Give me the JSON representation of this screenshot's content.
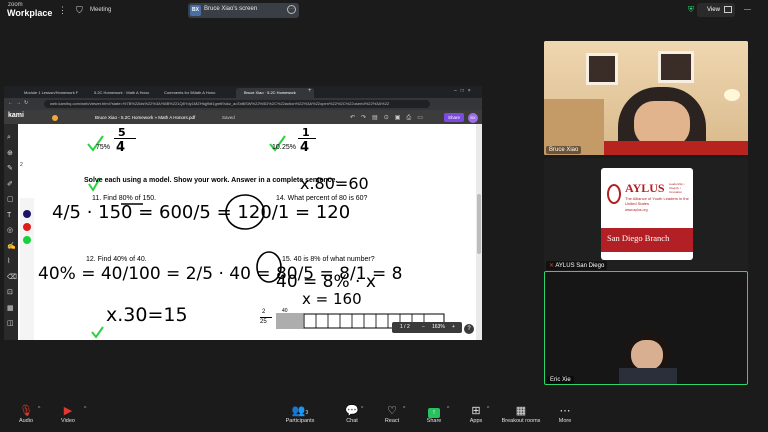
{
  "app": {
    "brand_top": "zoom",
    "brand_bottom": "Workplace"
  },
  "topbar": {
    "meeting_label": "Meeting",
    "share_initials": "BX",
    "share_title": "Bruce Xiao's screen",
    "view_label": "View"
  },
  "browser": {
    "tabs": [
      {
        "label": "Module 1 Lesson/Homework F"
      },
      {
        "label": "5.2C Homework · Math A Hono"
      },
      {
        "label": "Comments for 5Math A Hono"
      },
      {
        "label": "Bruce Xiao · 5.2C Homework"
      }
    ],
    "url": "web.kamihq.com/web/viewer.html?state=%7B%22ids%22%3A%5B%221Q6Ydy1MZHtqj9dt1gmtI9ukz_aoTaf6SW%22%5D%2C%22action%22%3A%22open%22%2C%22userId%22%3A%22"
  },
  "kami": {
    "logo": "kami",
    "breadcrumb": "Bruce Xiao - 5.2C Homework » Math A Honors.pdf",
    "saved": "Saved",
    "share": "Share",
    "user_initials": "BX",
    "tool_number": "2"
  },
  "doc": {
    "top_left_pct": "75%",
    "top_right_pct": "25%",
    "top_left_num": "5",
    "top_left_den": "4",
    "top_right_num": "1",
    "top_right_den": "4",
    "top_right_qn": "10.",
    "instructions": "Solve each using a model. Show your work. Answer in a complete sentence.",
    "q11": "11. Find 80% of 150.",
    "q14": "14. What percent of 80 is 60?",
    "q12": "12. Find 40% of 40.",
    "q15": "15. 40 is 8% of what number?",
    "hw_top": "x.80=60",
    "hw_q11": "4/5 · 150 = 600/5 = 120/1 = 120",
    "hw_q12": "40% = 40/100 = 2/5 · 40 = 80/5 = 8/1 = 8",
    "hw_q15_line1": "40 = 8% · x",
    "hw_q15_line2": "x = 160",
    "hw_bottom": "x.30=15",
    "hw_frac_num": "2",
    "hw_frac_den": "25",
    "tape_value": "40",
    "page_indicator": "1 / 2",
    "zoom": "163%"
  },
  "participants": [
    {
      "name": "Bruce Xiao"
    },
    {
      "name": "AYLUS San Diego"
    },
    {
      "name": "Eric Xie"
    }
  ],
  "aylus": {
    "logo": "AYLUS",
    "tagline_top": "Leadership • Integrity • Innovation",
    "tagline": "The Alliance of Youth Leaders in the United States",
    "url": "www.aylus.org",
    "branch": "San Diego Branch"
  },
  "controls": [
    {
      "label": "Audio"
    },
    {
      "label": "Video"
    },
    {
      "label": "Participants",
      "count": "3"
    },
    {
      "label": "Chat"
    },
    {
      "label": "React"
    },
    {
      "label": "Share"
    },
    {
      "label": "Apps"
    },
    {
      "label": "Breakout rooms"
    },
    {
      "label": "More"
    }
  ],
  "colors": {
    "accent": "#2ed36e",
    "share_green": "#27c25f",
    "stop_red": "#e0382f",
    "kami_purple": "#7b4ae0"
  }
}
